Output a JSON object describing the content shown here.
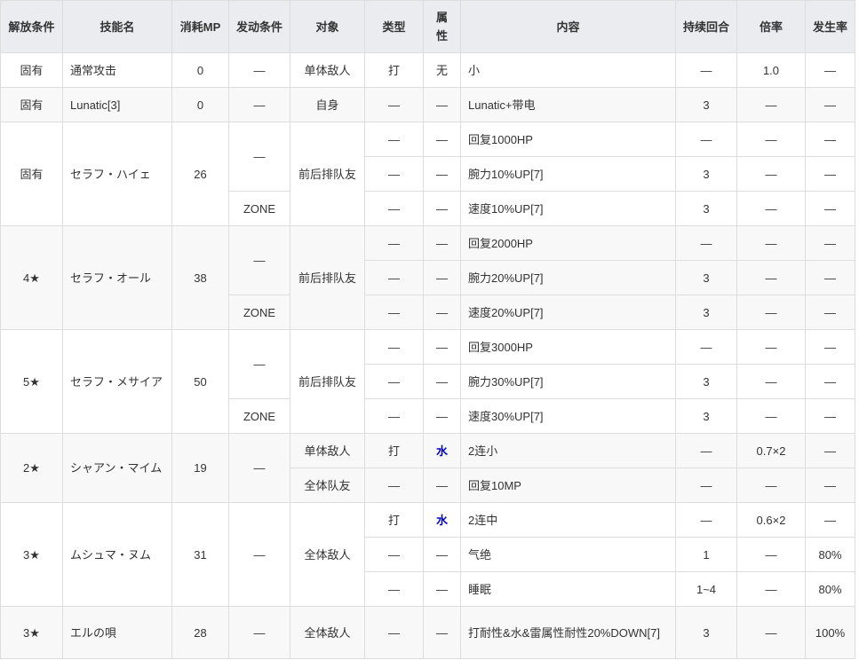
{
  "header": [
    "解放条件",
    "技能名",
    "消耗MP",
    "发动条件",
    "对象",
    "类型",
    "属性",
    "内容",
    "持续回合",
    "倍率",
    "发生率"
  ],
  "groups": [
    {
      "rows": [
        [
          [
            "unlock",
            "固有",
            1
          ],
          [
            "skill",
            "通常攻击",
            1
          ],
          [
            "mp",
            "0",
            1
          ],
          [
            "cond",
            "—",
            1
          ],
          [
            "target",
            "单体敌人",
            1
          ],
          [
            "type",
            "打",
            1
          ],
          [
            "attr",
            "无",
            1
          ],
          [
            "content",
            "小",
            1
          ],
          [
            "turns",
            "—",
            1
          ],
          [
            "rate",
            "1.0",
            1
          ],
          [
            "chance",
            "—",
            1
          ]
        ]
      ]
    },
    {
      "rows": [
        [
          [
            "unlock",
            "固有",
            1
          ],
          [
            "skill",
            "Lunatic[3]",
            1
          ],
          [
            "mp",
            "0",
            1
          ],
          [
            "cond",
            "—",
            1
          ],
          [
            "target",
            "自身",
            1
          ],
          [
            "type",
            "—",
            1
          ],
          [
            "attr",
            "—",
            1
          ],
          [
            "content",
            "Lunatic+带电",
            1
          ],
          [
            "turns",
            "3",
            1
          ],
          [
            "rate",
            "—",
            1
          ],
          [
            "chance",
            "—",
            1
          ]
        ]
      ]
    },
    {
      "rows": [
        [
          [
            "unlock",
            "固有",
            3
          ],
          [
            "skill",
            "セラフ・ハイェ",
            3
          ],
          [
            "mp",
            "26",
            3
          ],
          [
            "cond",
            "—",
            2
          ],
          [
            "target",
            "前后排队友",
            3
          ],
          [
            "type",
            "—",
            1
          ],
          [
            "attr",
            "—",
            1
          ],
          [
            "content",
            "回复1000HP",
            1
          ],
          [
            "turns",
            "—",
            1
          ],
          [
            "rate",
            "—",
            1
          ],
          [
            "chance",
            "—",
            1
          ]
        ],
        [
          [
            "type",
            "—",
            1
          ],
          [
            "attr",
            "—",
            1
          ],
          [
            "content",
            "腕力10%UP[7]",
            1
          ],
          [
            "turns",
            "3",
            1
          ],
          [
            "rate",
            "—",
            1
          ],
          [
            "chance",
            "—",
            1
          ]
        ],
        [
          [
            "cond",
            "ZONE",
            1
          ],
          [
            "type",
            "—",
            1
          ],
          [
            "attr",
            "—",
            1
          ],
          [
            "content",
            "速度10%UP[7]",
            1
          ],
          [
            "turns",
            "3",
            1
          ],
          [
            "rate",
            "—",
            1
          ],
          [
            "chance",
            "—",
            1
          ]
        ]
      ]
    },
    {
      "rows": [
        [
          [
            "unlock",
            "4★",
            3
          ],
          [
            "skill",
            "セラフ・オール",
            3
          ],
          [
            "mp",
            "38",
            3
          ],
          [
            "cond",
            "—",
            2
          ],
          [
            "target",
            "前后排队友",
            3
          ],
          [
            "type",
            "—",
            1
          ],
          [
            "attr",
            "—",
            1
          ],
          [
            "content",
            "回复2000HP",
            1
          ],
          [
            "turns",
            "—",
            1
          ],
          [
            "rate",
            "—",
            1
          ],
          [
            "chance",
            "—",
            1
          ]
        ],
        [
          [
            "type",
            "—",
            1
          ],
          [
            "attr",
            "—",
            1
          ],
          [
            "content",
            "腕力20%UP[7]",
            1
          ],
          [
            "turns",
            "3",
            1
          ],
          [
            "rate",
            "—",
            1
          ],
          [
            "chance",
            "—",
            1
          ]
        ],
        [
          [
            "cond",
            "ZONE",
            1
          ],
          [
            "type",
            "—",
            1
          ],
          [
            "attr",
            "—",
            1
          ],
          [
            "content",
            "速度20%UP[7]",
            1
          ],
          [
            "turns",
            "3",
            1
          ],
          [
            "rate",
            "—",
            1
          ],
          [
            "chance",
            "—",
            1
          ]
        ]
      ]
    },
    {
      "rows": [
        [
          [
            "unlock",
            "5★",
            3
          ],
          [
            "skill",
            "セラフ・メサイア",
            3
          ],
          [
            "mp",
            "50",
            3
          ],
          [
            "cond",
            "—",
            2
          ],
          [
            "target",
            "前后排队友",
            3
          ],
          [
            "type",
            "—",
            1
          ],
          [
            "attr",
            "—",
            1
          ],
          [
            "content",
            "回复3000HP",
            1
          ],
          [
            "turns",
            "—",
            1
          ],
          [
            "rate",
            "—",
            1
          ],
          [
            "chance",
            "—",
            1
          ]
        ],
        [
          [
            "type",
            "—",
            1
          ],
          [
            "attr",
            "—",
            1
          ],
          [
            "content",
            "腕力30%UP[7]",
            1
          ],
          [
            "turns",
            "3",
            1
          ],
          [
            "rate",
            "—",
            1
          ],
          [
            "chance",
            "—",
            1
          ]
        ],
        [
          [
            "cond",
            "ZONE",
            1
          ],
          [
            "type",
            "—",
            1
          ],
          [
            "attr",
            "—",
            1
          ],
          [
            "content",
            "速度30%UP[7]",
            1
          ],
          [
            "turns",
            "3",
            1
          ],
          [
            "rate",
            "—",
            1
          ],
          [
            "chance",
            "—",
            1
          ]
        ]
      ]
    },
    {
      "rows": [
        [
          [
            "unlock",
            "2★",
            2
          ],
          [
            "skill",
            "シャアン・マイム",
            2
          ],
          [
            "mp",
            "19",
            2
          ],
          [
            "cond",
            "—",
            2
          ],
          [
            "target",
            "单体敌人",
            1
          ],
          [
            "type",
            "打",
            1
          ],
          [
            "attr",
            "水",
            1
          ],
          [
            "content",
            "2连小",
            1
          ],
          [
            "turns",
            "—",
            1
          ],
          [
            "rate",
            "0.7×2",
            1
          ],
          [
            "chance",
            "—",
            1
          ]
        ],
        [
          [
            "target",
            "全体队友",
            1
          ],
          [
            "type",
            "—",
            1
          ],
          [
            "attr",
            "—",
            1
          ],
          [
            "content",
            "回复10MP",
            1
          ],
          [
            "turns",
            "—",
            1
          ],
          [
            "rate",
            "—",
            1
          ],
          [
            "chance",
            "—",
            1
          ]
        ]
      ]
    },
    {
      "rows": [
        [
          [
            "unlock",
            "3★",
            3
          ],
          [
            "skill",
            "ムシュマ・ヌム",
            3
          ],
          [
            "mp",
            "31",
            3
          ],
          [
            "cond",
            "—",
            3
          ],
          [
            "target",
            "全体敌人",
            3
          ],
          [
            "type",
            "打",
            1
          ],
          [
            "attr",
            "水",
            1
          ],
          [
            "content",
            "2连中",
            1
          ],
          [
            "turns",
            "—",
            1
          ],
          [
            "rate",
            "0.6×2",
            1
          ],
          [
            "chance",
            "—",
            1
          ]
        ],
        [
          [
            "type",
            "—",
            1
          ],
          [
            "attr",
            "—",
            1
          ],
          [
            "content",
            "气绝",
            1
          ],
          [
            "turns",
            "1",
            1
          ],
          [
            "rate",
            "—",
            1
          ],
          [
            "chance",
            "80%",
            1
          ]
        ],
        [
          [
            "type",
            "—",
            1
          ],
          [
            "attr",
            "—",
            1
          ],
          [
            "content",
            "睡眠",
            1
          ],
          [
            "turns",
            "1~4",
            1
          ],
          [
            "rate",
            "—",
            1
          ],
          [
            "chance",
            "80%",
            1
          ]
        ]
      ]
    },
    {
      "rows": [
        [
          [
            "unlock",
            "3★",
            1
          ],
          [
            "skill",
            "エルの唄",
            1
          ],
          [
            "mp",
            "28",
            1
          ],
          [
            "cond",
            "—",
            1
          ],
          [
            "target",
            "全体敌人",
            1
          ],
          [
            "type",
            "—",
            1
          ],
          [
            "attr",
            "—",
            1
          ],
          [
            "content",
            "打耐性&水&雷属性耐性20%DOWN[7]",
            1
          ],
          [
            "turns",
            "3",
            1
          ],
          [
            "rate",
            "—",
            1
          ],
          [
            "chance",
            "100%",
            1
          ]
        ]
      ]
    }
  ],
  "colors": {
    "header_bg": "#eaecf0",
    "alt_row_bg": "#f8f8f8",
    "border": "#dddddd",
    "water": "#0000cc"
  }
}
